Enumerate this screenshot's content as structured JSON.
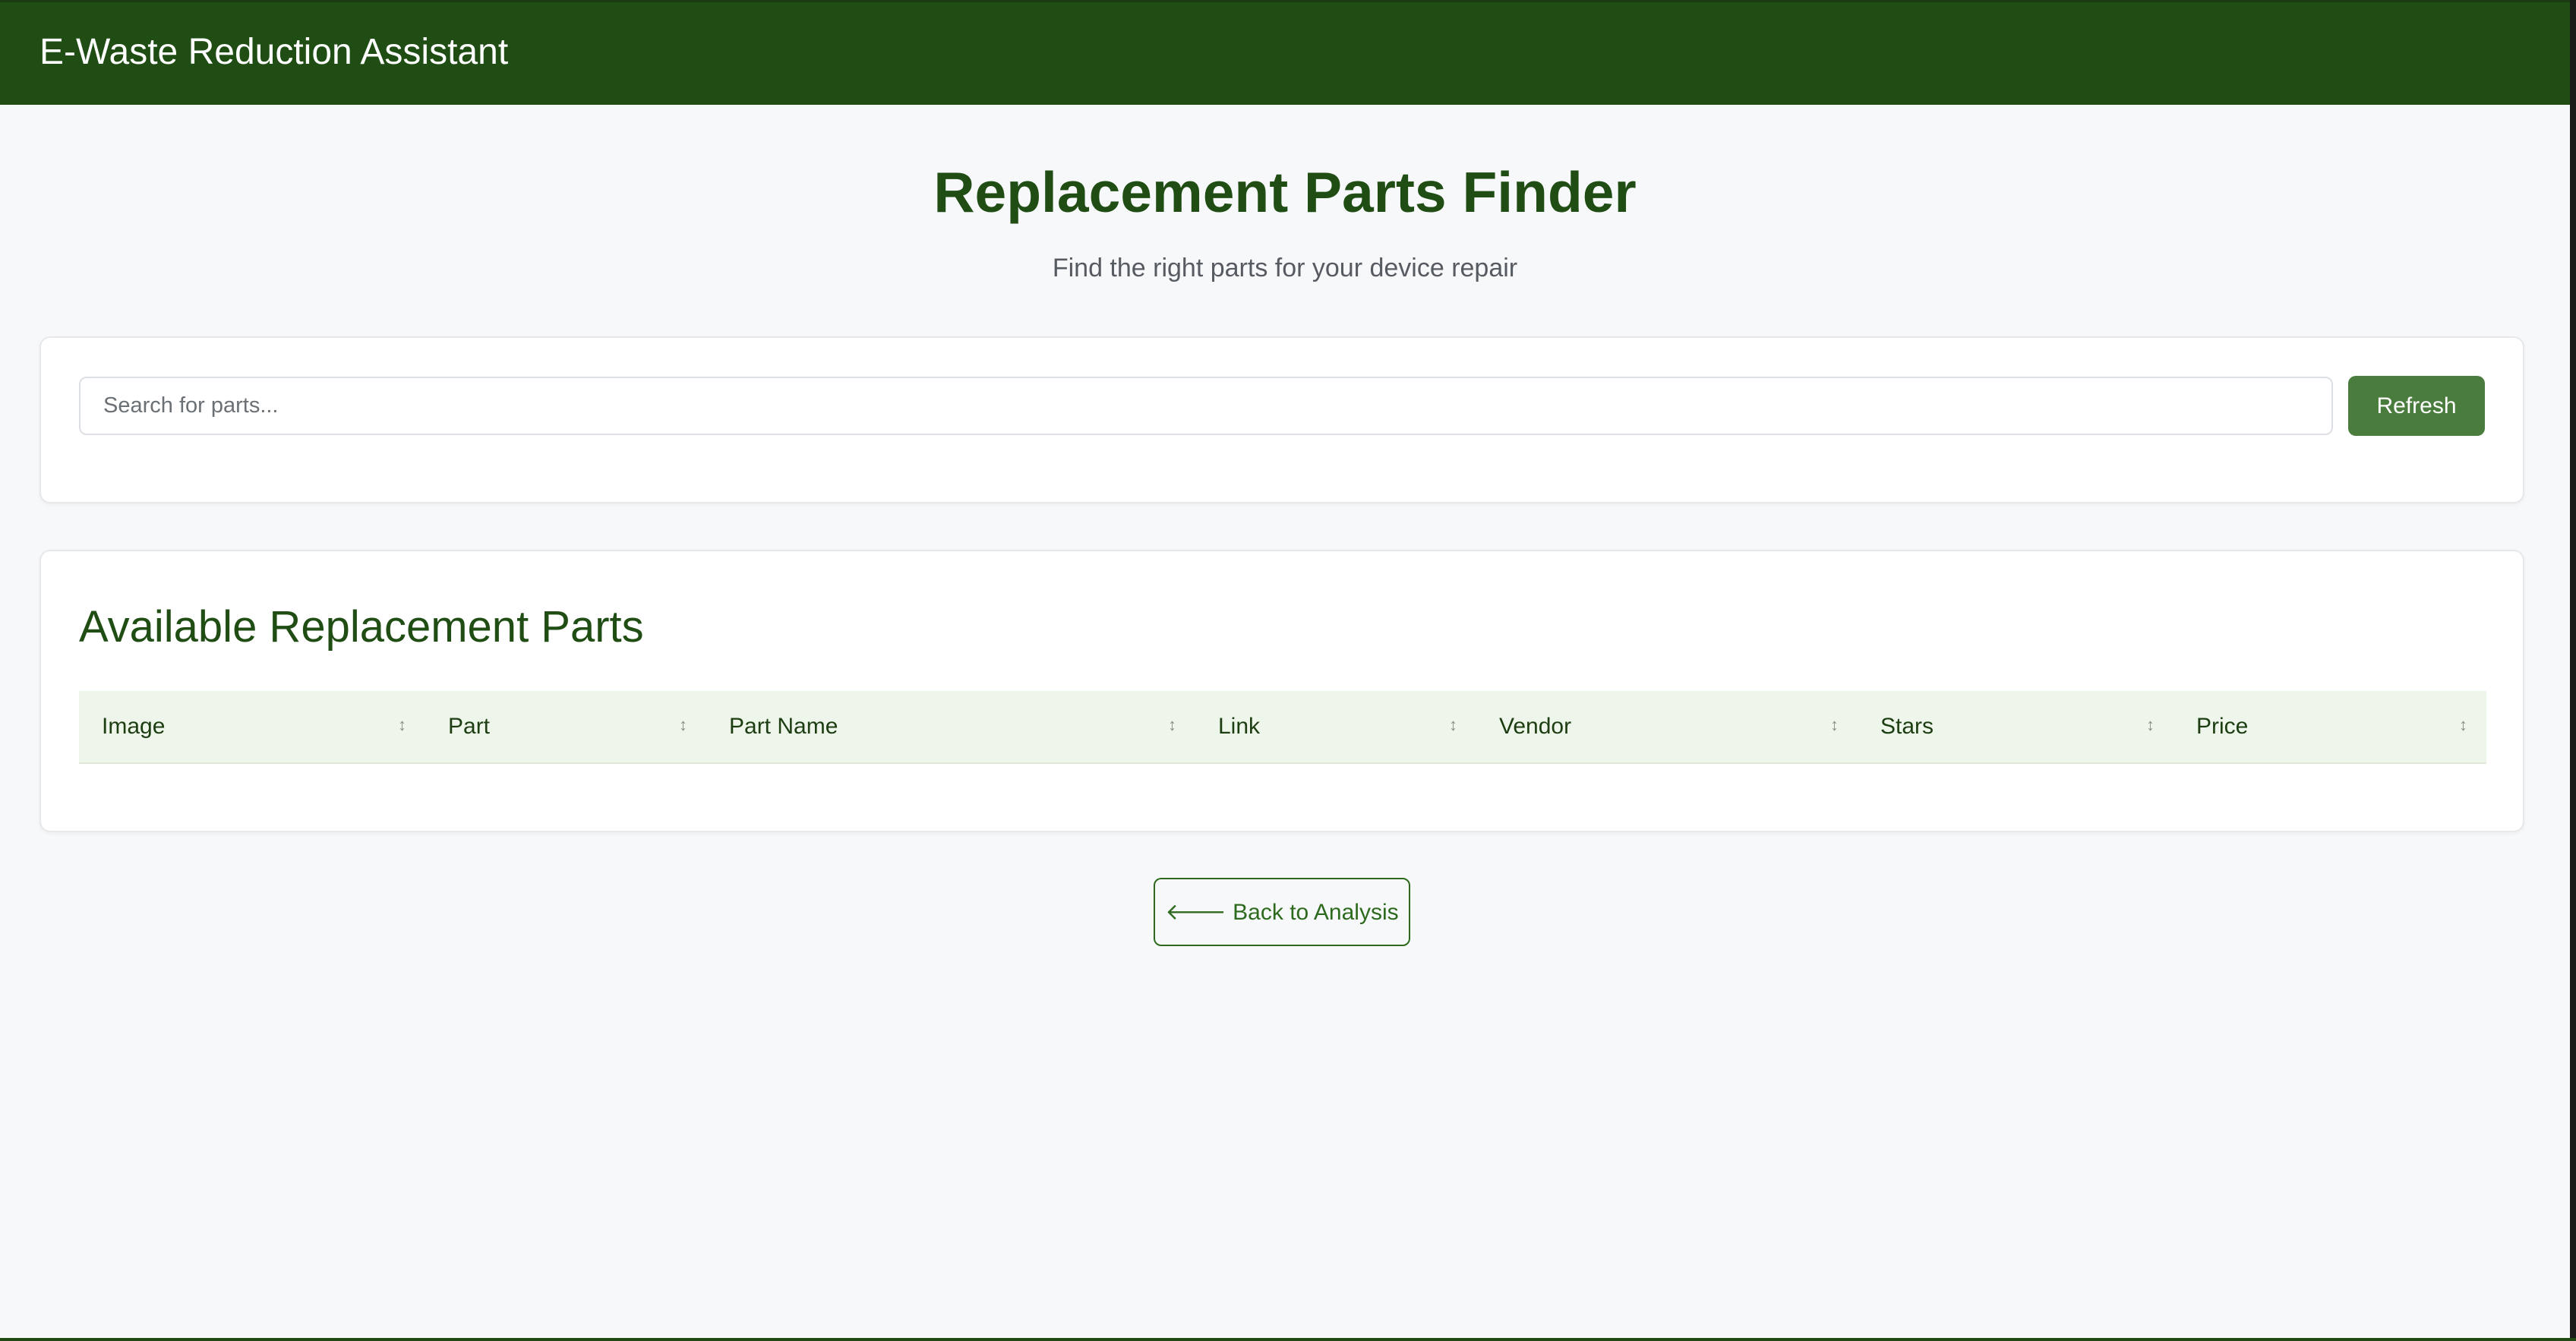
{
  "app": {
    "title": "E-Waste Reduction Assistant"
  },
  "page": {
    "title": "Replacement Parts Finder",
    "subtitle": "Find the right parts for your device repair"
  },
  "search": {
    "value": "",
    "placeholder": "Search for parts...",
    "refresh_label": "Refresh"
  },
  "parts": {
    "heading": "Available Replacement Parts",
    "columns": [
      {
        "label": "Image",
        "sort_icon": "sort-icon"
      },
      {
        "label": "Part",
        "sort_icon": "sort-icon"
      },
      {
        "label": "Part Name",
        "sort_icon": "sort-icon"
      },
      {
        "label": "Link",
        "sort_icon": "sort-icon"
      },
      {
        "label": "Vendor",
        "sort_icon": "sort-icon"
      },
      {
        "label": "Stars",
        "sort_icon": "sort-icon"
      },
      {
        "label": "Price",
        "sort_icon": "sort-icon"
      }
    ],
    "rows": []
  },
  "navigation": {
    "back_label": "Back to Analysis",
    "back_icon": "arrow-left-icon"
  },
  "colors": {
    "header_bg": "#1f4d14",
    "accent": "#4a7c3e",
    "heading": "#1f4d14",
    "table_header_bg": "#eef5ea",
    "page_bg": "#f7f8fa"
  }
}
